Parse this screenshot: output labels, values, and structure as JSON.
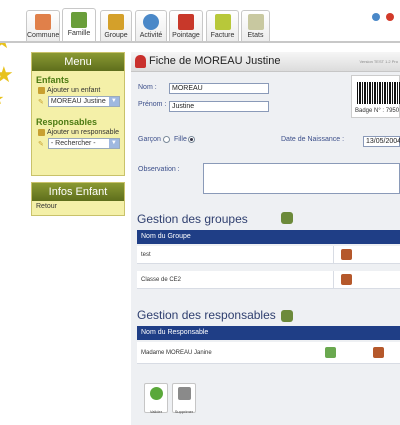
{
  "tabs": [
    {
      "label": "Commune",
      "icon": "house-icon",
      "color": "#e0804a"
    },
    {
      "label": "Famille",
      "icon": "family-icon",
      "color": "#6a9e3a",
      "active": true
    },
    {
      "label": "Groupe",
      "icon": "group-icon",
      "color": "#d4a02a"
    },
    {
      "label": "Activité",
      "icon": "globe-icon",
      "color": "#4a88c8"
    },
    {
      "label": "Pointage",
      "icon": "calendar-icon",
      "color": "#c8382a"
    },
    {
      "label": "Facture",
      "icon": "invoice-icon",
      "color": "#b8c83a"
    },
    {
      "label": "Etats",
      "icon": "report-icon",
      "color": "#c8c8a0"
    }
  ],
  "menu": {
    "title": "Menu",
    "enfants_title": "Enfants",
    "add_child": "Ajouter un enfant",
    "child_select": "MOREAU Justine",
    "responsables_title": "Responsables",
    "add_responsable": "Ajouter un responsable",
    "responsable_select": "- Rechercher -"
  },
  "infos": {
    "title": "Infos Enfant",
    "link": "Retour"
  },
  "fiche": {
    "title": "Fiche de MOREAU Justine",
    "meta": "Version TEST 1.2 Pro",
    "nom_label": "Nom :",
    "nom_value": "MOREAU",
    "prenom_label": "Prénom :",
    "prenom_value": "Justine",
    "badge": "Badge N° : 7950",
    "garcon_label": "Garçon",
    "fille_label": "Fille",
    "naissance_label": "Date de Naissance :",
    "naissance_value": "13/05/2004",
    "observation_label": "Observation :"
  },
  "groupes": {
    "title": "Gestion des groupes",
    "column": "Nom du Groupe",
    "rows": [
      "test",
      "Classe de CE2"
    ]
  },
  "responsables": {
    "title": "Gestion des responsables",
    "column": "Nom du Responsable",
    "rows": [
      "Madame MOREAU Janine"
    ]
  },
  "actions": {
    "valider": "Valider",
    "supprimer": "Supprimer"
  }
}
